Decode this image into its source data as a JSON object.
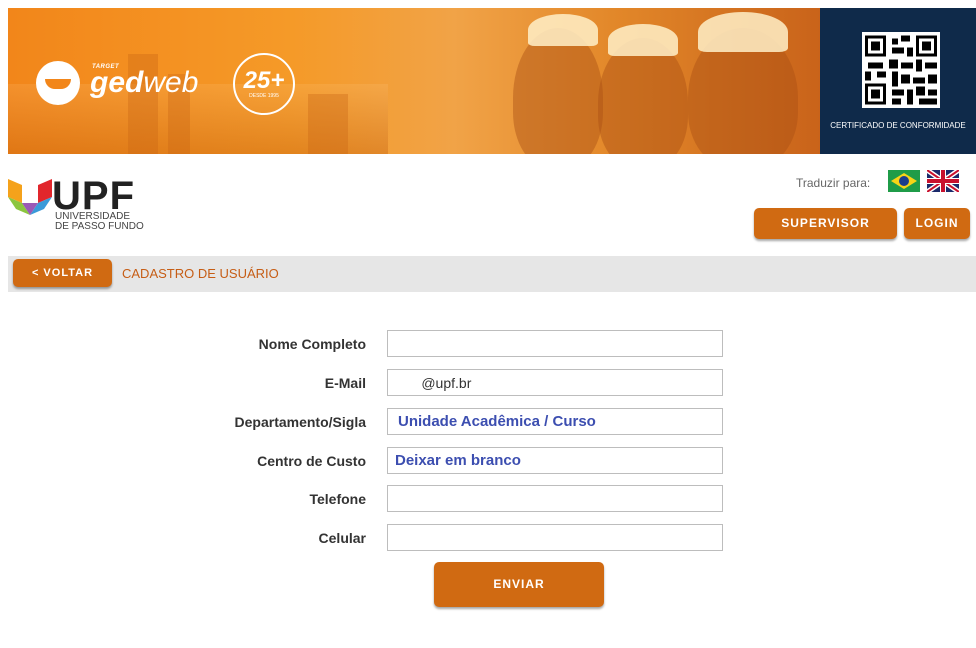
{
  "banner": {
    "brand_small": "TARGET",
    "brand_name_bold": "ged",
    "brand_name_light": "web",
    "anniversary_number": "25+",
    "anniversary_since": "DESDE 1995",
    "certificate_label": "CERTIFICADO DE CONFORMIDADE"
  },
  "organization": {
    "name": "UPF",
    "subtitle_line1": "UNIVERSIDADE",
    "subtitle_line2": "DE PASSO FUNDO"
  },
  "header": {
    "translate_label": "Traduzir para:",
    "languages": [
      "brazil-flag-icon",
      "uk-flag-icon"
    ],
    "supervisor_label": "SUPERVISOR",
    "login_label": "LOGIN"
  },
  "toolbar": {
    "back_label": "< VOLTAR",
    "page_title": "CADASTRO DE USUÁRIO"
  },
  "form": {
    "fields": [
      {
        "label": "Nome Completo",
        "value": ""
      },
      {
        "label": "E-Mail",
        "value": "      @upf.br"
      },
      {
        "label": "Departamento/Sigla",
        "value": "Unidade Acadêmica / Curso"
      },
      {
        "label": "Centro de Custo",
        "value": "Deixar em branco"
      },
      {
        "label": "Telefone",
        "value": ""
      },
      {
        "label": "Celular",
        "value": ""
      }
    ],
    "submit_label": "ENVIAR"
  },
  "colors": {
    "accent": "#d06a12",
    "title": "#c65d15",
    "banner_orange": "#f2861a",
    "cert_navy": "#0f2a4a",
    "field_highlight": "#3c4eb0"
  }
}
